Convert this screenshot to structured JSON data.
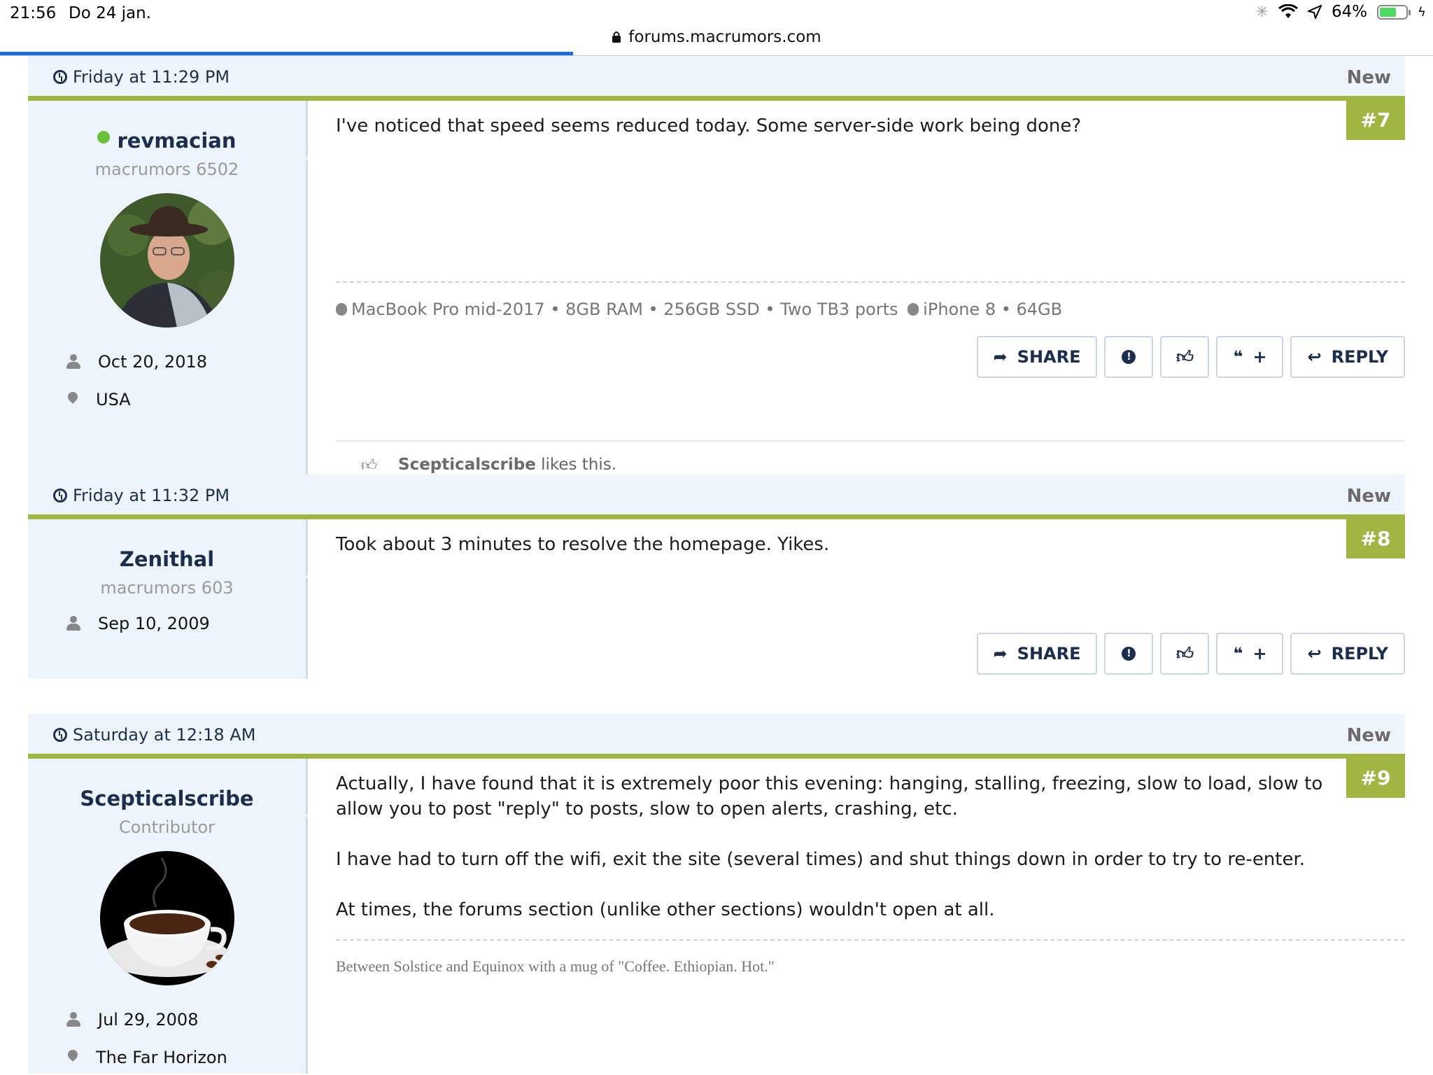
{
  "status_bar": {
    "time": "21:56",
    "date": "Do 24 jan.",
    "battery": "64%",
    "battery_level": 0.64
  },
  "url_bar": {
    "url": "forums.macrumors.com",
    "load_progress": 0.4
  },
  "colors": {
    "accent_green": "#a1b542",
    "navy": "#1b2e4c",
    "panel_bg": "#eef4fb",
    "online": "#67c23a"
  },
  "posts": [
    {
      "date": "Friday at 11:29 PM",
      "new_label": "New",
      "number": "#7",
      "user": {
        "name": "revmacian",
        "title": "macrumors 6502",
        "joined": "Oct 20, 2018",
        "location": "USA",
        "online": true
      },
      "message": [
        "I've noticed that speed seems reduced today. Some server-side work being done?"
      ],
      "signature": "MacBook Pro mid-2017 • 8GB RAM • 256GB SSD • Two TB3 ports",
      "signature2": "iPhone 8 • 64GB",
      "likes": {
        "user": "Scepticalscribe",
        "text": "likes this."
      }
    },
    {
      "date": "Friday at 11:32 PM",
      "new_label": "New",
      "number": "#8",
      "user": {
        "name": "Zenithal",
        "title": "macrumors 603",
        "joined": "Sep 10, 2009"
      },
      "message": [
        "Took about 3 minutes to resolve the homepage. Yikes."
      ]
    },
    {
      "date": "Saturday at 12:18 AM",
      "new_label": "New",
      "number": "#9",
      "user": {
        "name": "Scepticalscribe",
        "title": "Contributor",
        "joined": "Jul 29, 2008",
        "location": "The Far Horizon"
      },
      "message": [
        "Actually, I have found that it is extremely poor this evening: hanging, stalling, freezing, slow to load, slow to allow you to post \"reply\" to posts, slow to open alerts, crashing, etc.",
        "I have had to turn off the wifi, exit the site (several times) and shut things down in order to try to re-enter.",
        "At times, the forums section (unlike other sections) wouldn't open at all."
      ],
      "signature": "Between Solstice and Equinox with a mug of \"Coffee. Ethiopian. Hot.\""
    }
  ],
  "buttons": {
    "share": "SHARE",
    "reply": "REPLY",
    "quote_plus": "+"
  },
  "icons": [
    "clock-icon",
    "share-arrow-icon",
    "report-icon",
    "thumbs-up-icon",
    "quote-icon",
    "reply-arrow-icon",
    "person-icon",
    "location-pin-icon",
    "lock-icon",
    "wifi-icon",
    "location-arrow-icon",
    "battery-icon",
    "apple-icon"
  ]
}
